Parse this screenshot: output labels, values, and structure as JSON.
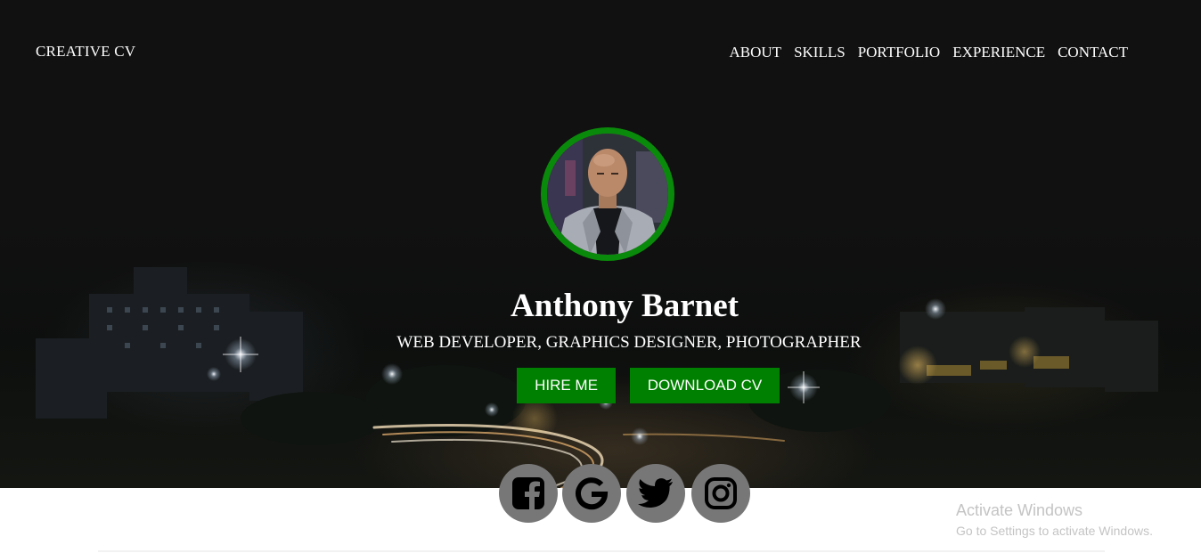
{
  "header": {
    "brand": "CREATIVE CV",
    "nav": [
      "ABOUT",
      "SKILLS",
      "PORTFOLIO",
      "EXPERIENCE",
      "CONTACT"
    ]
  },
  "hero": {
    "name": "Anthony Barnet",
    "subtitle": "WEB DEVELOPER, GRAPHICS DESIGNER, PHOTOGRAPHER",
    "hire_label": "HIRE ME",
    "download_label": "DOWNLOAD CV"
  },
  "social": {
    "icons": [
      "facebook-icon",
      "google-icon",
      "twitter-icon",
      "instagram-icon"
    ]
  },
  "watermark": {
    "title": "Activate Windows",
    "subtitle": "Go to Settings to activate Windows."
  },
  "colors": {
    "accent": "#008000",
    "avatar_ring": "#0a8a0a",
    "hero_bg": "#111111",
    "social_bg": "#777777"
  }
}
